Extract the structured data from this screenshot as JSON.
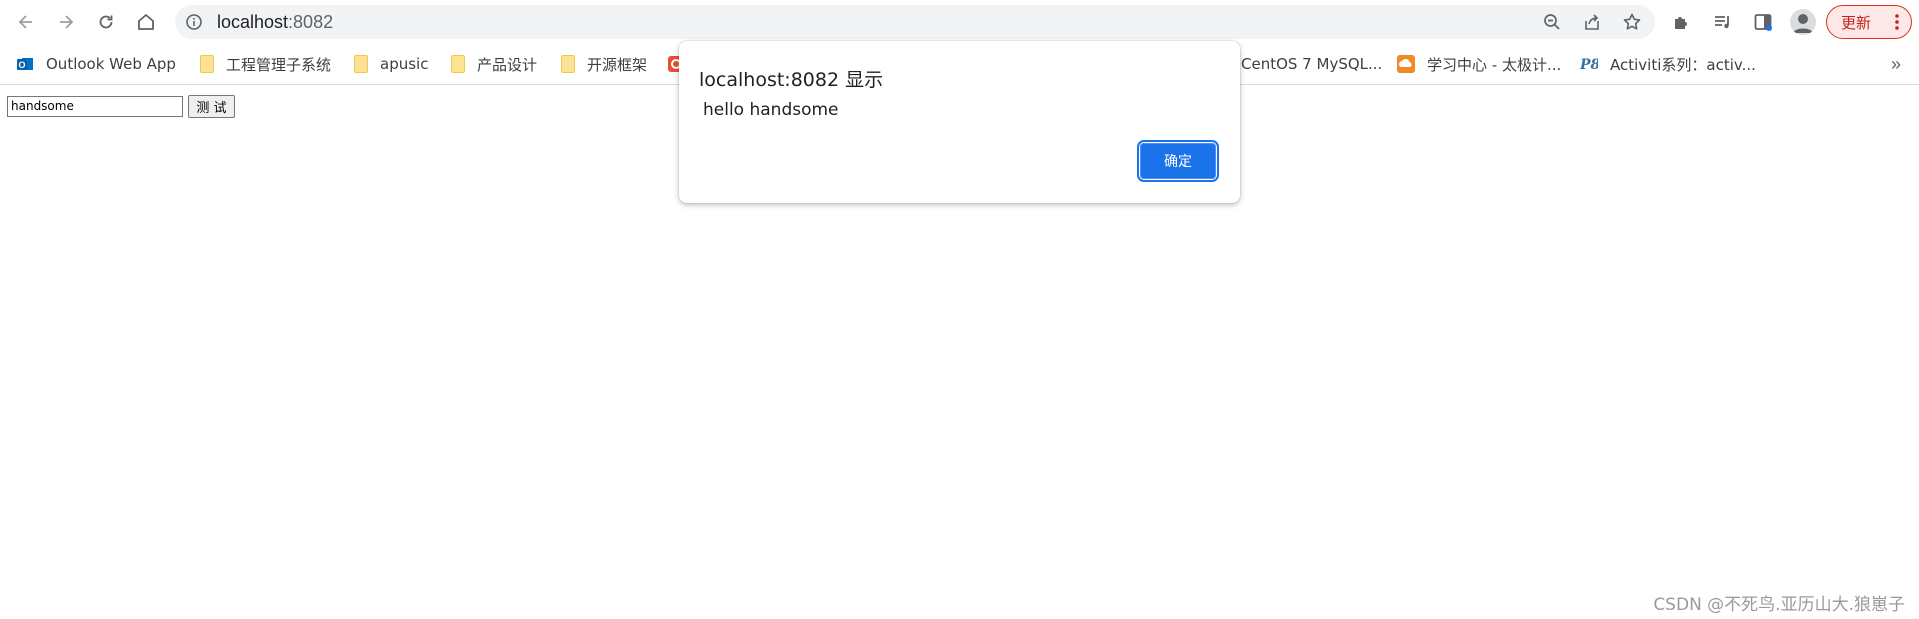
{
  "browser": {
    "omnibox": {
      "host": "localhost",
      "port": ":8082"
    },
    "update_button_label": "更新",
    "icons": {
      "back": "arrow-left-icon",
      "forward": "arrow-right-icon",
      "reload": "reload-icon",
      "home": "home-icon",
      "site_info": "info-circle-icon",
      "zoom": "zoom-out-icon",
      "share": "share-icon",
      "bookmark": "star-icon",
      "extensions": "puzzle-icon",
      "media": "media-list-icon",
      "side_panel": "side-panel-icon",
      "profile": "avatar-icon",
      "menu": "kebab-menu-icon"
    }
  },
  "bookmarks": [
    {
      "label": "Outlook Web App",
      "icon": "outlook-icon"
    },
    {
      "label": "工程管理子系统",
      "icon": "folder-icon"
    },
    {
      "label": "apusic",
      "icon": "folder-icon"
    },
    {
      "label": "产品设计",
      "icon": "folder-icon"
    },
    {
      "label": "开源框架",
      "icon": "folder-icon"
    },
    {
      "label": "CentOS 7 MySQL...",
      "icon": "site-icon"
    },
    {
      "label": "学习中心 - 太极计...",
      "icon": "cloud-icon"
    },
    {
      "label": "Activiti系列：activ...",
      "icon": "ps-icon"
    }
  ],
  "bookmarks_more": "»",
  "page": {
    "input_value": "handsome",
    "button_label": "测 试"
  },
  "dialog": {
    "title": "localhost:8082 显示",
    "message": "hello handsome",
    "ok_label": "确定"
  },
  "watermark": "CSDN @不死鸟.亚历山大.狼崽子",
  "colors": {
    "accent": "#1a73e8",
    "update_red": "#d93025",
    "omnibox_bg": "#f1f3f4"
  }
}
